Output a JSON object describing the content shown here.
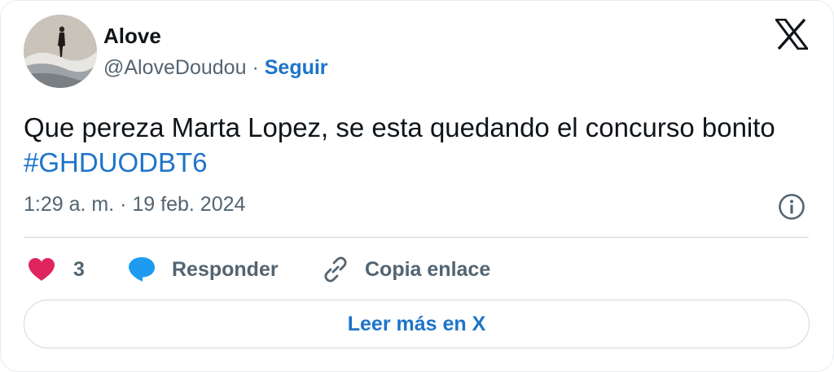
{
  "author": {
    "name": "Alove",
    "handle": "@AloveDoudou",
    "separator": "·",
    "follow_label": "Seguir"
  },
  "tweet": {
    "text": "Que pereza Marta Lopez, se esta quedando el concurso bonito ",
    "hashtag": "#GHDUODBT6",
    "timestamp": "1:29 a. m. · 19 feb. 2024"
  },
  "actions": {
    "like_count": "3",
    "reply_label": "Responder",
    "copy_link_label": "Copia enlace"
  },
  "read_more_label": "Leer más en X",
  "icons": {
    "platform": "x-logo-icon",
    "info": "info-icon",
    "like": "heart-icon",
    "reply": "speech-bubble-icon",
    "copy": "link-icon"
  },
  "colors": {
    "accent": "#1d74c9",
    "like": "#e0245e",
    "reply": "#1d9bf0",
    "muted": "#536471",
    "text": "#0f1419"
  }
}
